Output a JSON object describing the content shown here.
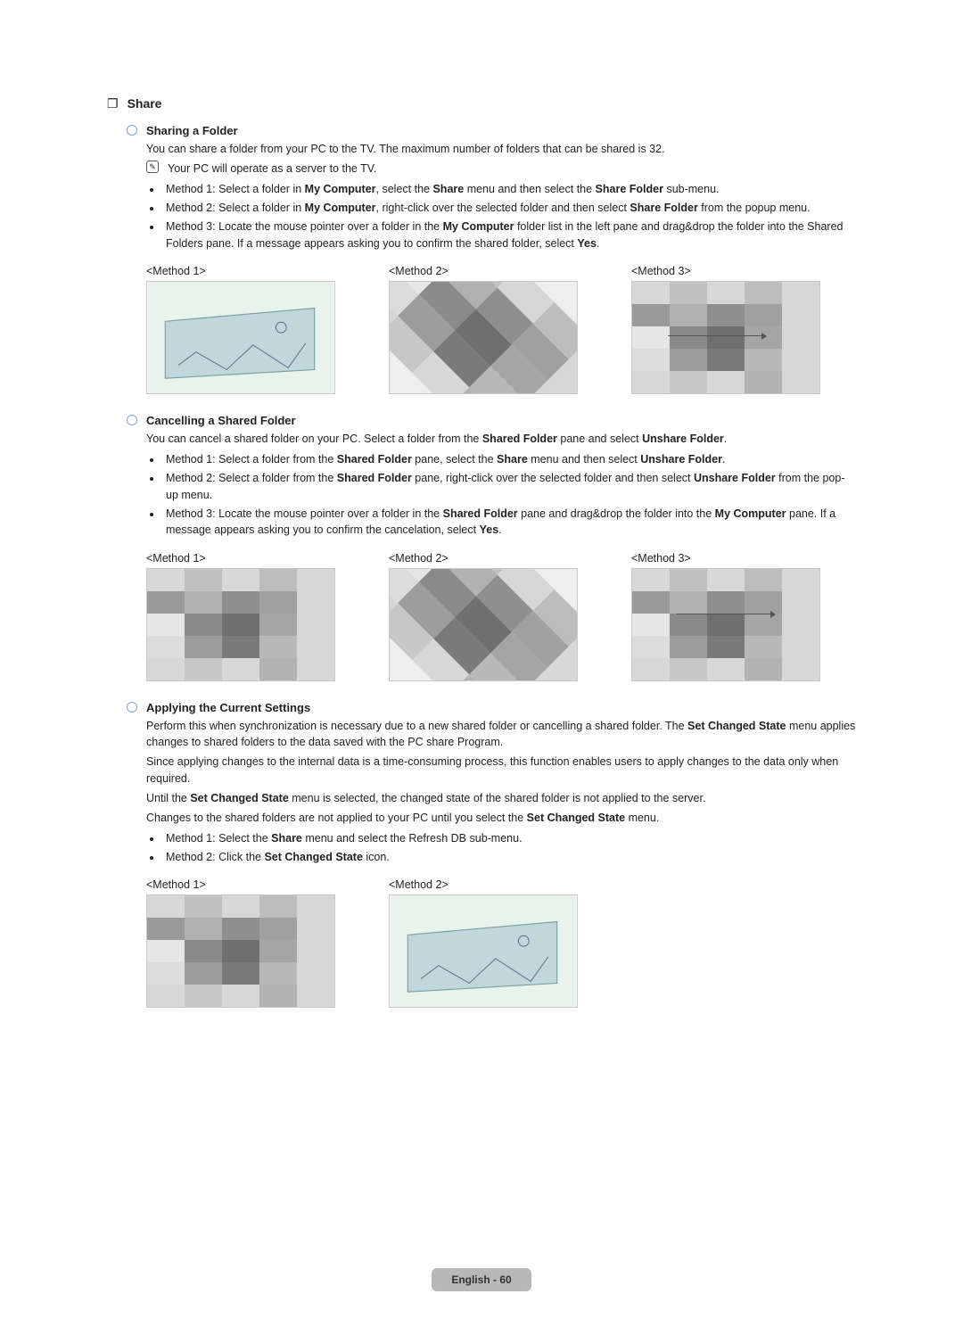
{
  "section": {
    "marker": "❐",
    "title": "Share"
  },
  "sharing": {
    "title": "Sharing a Folder",
    "intro": "You can share a folder from your PC to the TV. The maximum number of folders that can be shared is 32.",
    "note": "Your PC will operate as a server to the TV.",
    "bullets": [
      {
        "pre": "Method 1: Select a folder in ",
        "b1": "My Computer",
        "mid1": ", select the ",
        "b2": "Share",
        "mid2": " menu and then select the ",
        "b3": "Share Folder",
        "post": " sub-menu."
      },
      {
        "pre": "Method 2: Select a folder in ",
        "b1": "My Computer",
        "mid1": ", right-click over the selected folder and then select ",
        "b2": "Share Folder",
        "post": " from the popup menu."
      },
      {
        "pre": "Method 3: Locate the mouse pointer over a folder in the ",
        "b1": "My Computer",
        "mid1": " folder list in the left pane and drag&drop the folder into the Shared Folders pane. If a message appears asking you to confirm the shared folder, select ",
        "b2": "Yes",
        "post": "."
      }
    ],
    "labels": [
      "<Method 1>",
      "<Method 2>",
      "<Method 3>"
    ]
  },
  "cancelling": {
    "title": "Cancelling a Shared Folder",
    "intro_pre": "You can cancel a shared folder on your PC. Select a folder from the ",
    "intro_b1": "Shared Folder",
    "intro_mid": " pane and select ",
    "intro_b2": "Unshare Folder",
    "intro_post": ".",
    "bullets": [
      {
        "pre": "Method 1: Select a folder from the ",
        "b1": "Shared Folder",
        "mid1": " pane, select the ",
        "b2": "Share",
        "mid2": " menu and then select ",
        "b3": "Unshare Folder",
        "post": "."
      },
      {
        "pre": "Method 2: Select a folder from the ",
        "b1": "Shared Folder",
        "mid1": " pane, right-click over the selected folder and then select ",
        "b2": "Unshare Folder",
        "post": " from the pop-up menu."
      },
      {
        "pre": "Method 3: Locate the mouse pointer over a folder in the ",
        "b1": "Shared Folder",
        "mid1": " pane and drag&drop the folder into the ",
        "b2": "My Computer",
        "mid2": " pane. If a message appears asking you to confirm the cancelation, select ",
        "b3": "Yes",
        "post": "."
      }
    ],
    "labels": [
      "<Method 1>",
      "<Method 2>",
      "<Method 3>"
    ]
  },
  "applying": {
    "title": "Applying the Current Settings",
    "p1_pre": "Perform this when synchronization is necessary due to a new shared folder or cancelling a shared folder. The ",
    "p1_b": "Set Changed State",
    "p1_post": " menu applies changes to shared folders to the data saved with the PC share Program.",
    "p2": "Since applying changes to the internal data is a time-consuming process, this function enables users to apply changes to the data only when required.",
    "p3_pre": "Until the ",
    "p3_b": "Set Changed State",
    "p3_post": " menu is selected, the changed state of the shared folder is not applied to the server.",
    "p4_pre": "Changes to the shared folders are not applied to your PC until you select the ",
    "p4_b": "Set Changed State",
    "p4_post": " menu.",
    "bullets": [
      {
        "pre": "Method 1: Select the ",
        "b1": "Share",
        "post": " menu and select the Refresh DB sub-menu."
      },
      {
        "pre": "Method 2: Click the ",
        "b1": "Set Changed State",
        "post": " icon."
      }
    ],
    "labels": [
      "<Method 1>",
      "<Method 2>"
    ]
  },
  "footer": "English - 60"
}
